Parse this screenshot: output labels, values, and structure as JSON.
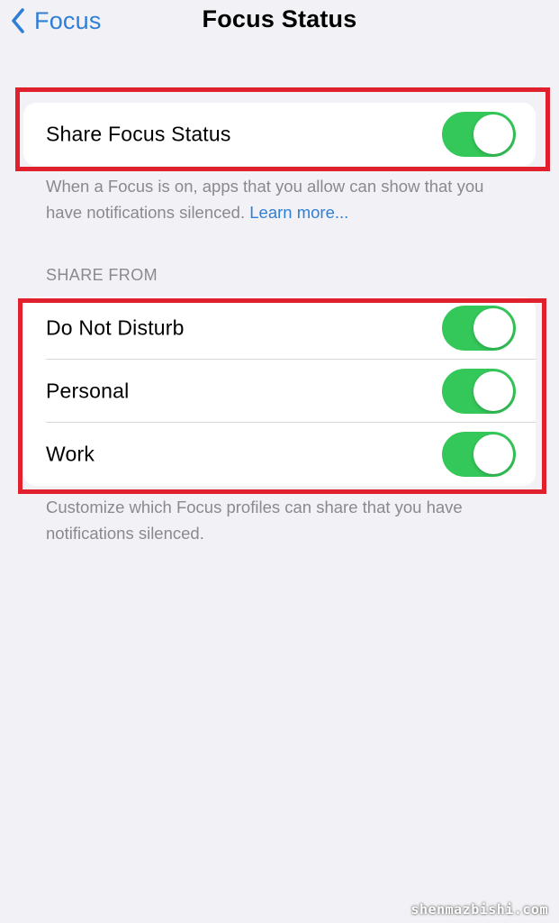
{
  "nav": {
    "back_label": "Focus",
    "title": "Focus Status"
  },
  "share_card": {
    "label": "Share Focus Status",
    "enabled": true,
    "footer_text": "When a Focus is on, apps that you allow can show that you have notifications silenced.",
    "learn_more": "Learn more..."
  },
  "share_from": {
    "header": "SHARE FROM",
    "items": [
      {
        "label": "Do Not Disturb",
        "enabled": true
      },
      {
        "label": "Personal",
        "enabled": true
      },
      {
        "label": "Work",
        "enabled": true
      }
    ],
    "footer_text": "Customize which Focus profiles can share that you have notifications silenced."
  },
  "watermark": "shenmazbishi.com",
  "colors": {
    "accent": "#2f7fd6",
    "toggle_on": "#34c759",
    "highlight": "#e0202c",
    "background": "#f2f2f6"
  },
  "icons": {
    "back": "chevron-left-icon"
  }
}
